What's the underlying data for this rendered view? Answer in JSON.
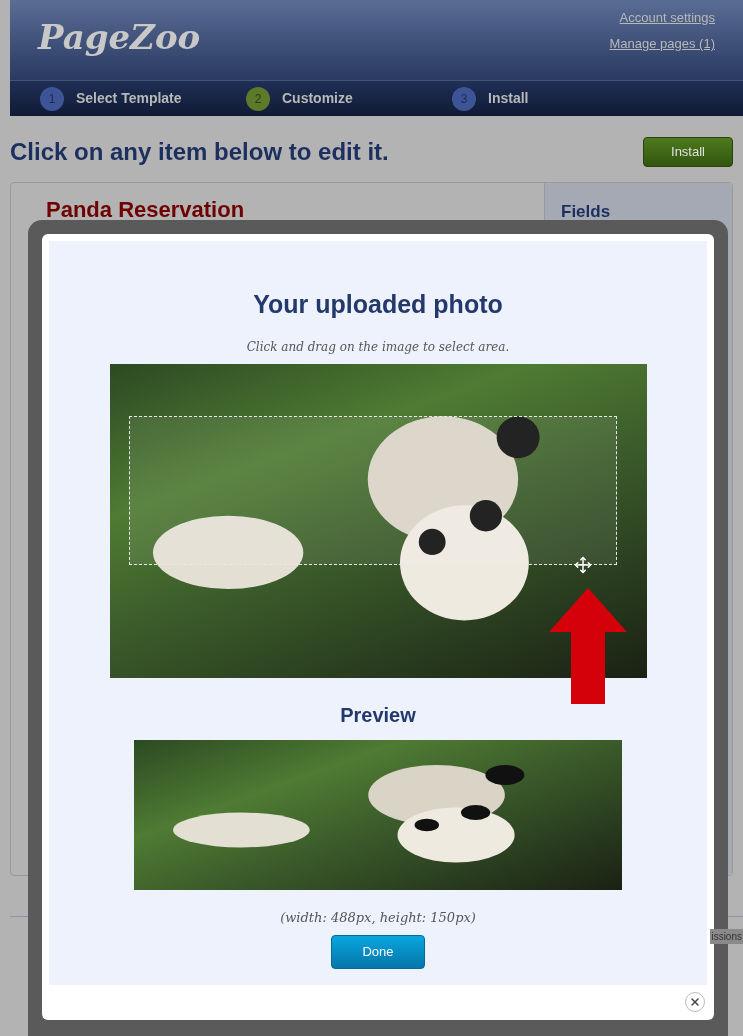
{
  "header": {
    "logo": "PageZoo",
    "links": [
      "Account settings",
      "Manage pages (1)"
    ]
  },
  "steps": [
    {
      "number": "1",
      "label": "Select Template",
      "selected": false
    },
    {
      "number": "2",
      "label": "Customize",
      "selected": true
    },
    {
      "number": "3",
      "label": "Install",
      "selected": false
    }
  ],
  "heading": "Click on any item below to edit it.",
  "install_button": "Install",
  "editor": {
    "title": "Panda Reservation",
    "footer_text": "issions"
  },
  "sidebar": {
    "title": "Fields"
  },
  "modal": {
    "title": "Your uploaded photo",
    "instruction": "Click and drag on the image to select area.",
    "preview_title": "Preview",
    "dimensions": "(width: 488px, height: 150px)",
    "done_button": "Done"
  }
}
